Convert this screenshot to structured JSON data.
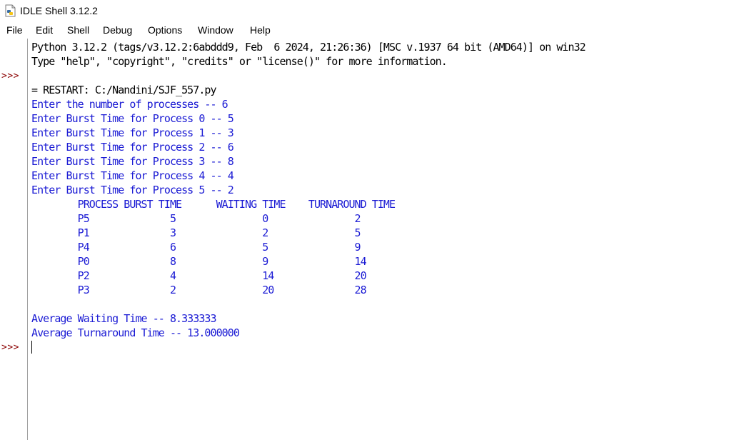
{
  "window": {
    "title": "IDLE Shell 3.12.2"
  },
  "menu": {
    "items": [
      "File",
      "Edit",
      "Shell",
      "Debug",
      "Options",
      "Window",
      "Help"
    ]
  },
  "shell": {
    "prompt": ">>>",
    "banner_line1": "Python 3.12.2 (tags/v3.12.2:6abddd9, Feb  6 2024, 21:26:36) [MSC v.1937 64 bit (AMD64)] on win32",
    "banner_line2": "Type \"help\", \"copyright\", \"credits\" or \"license()\" for more information.",
    "restart_line": "= RESTART: C:/Nandini/SJF_557.py",
    "output_lines": [
      "Enter the number of processes -- 6",
      "Enter Burst Time for Process 0 -- 5",
      "Enter Burst Time for Process 1 -- 3",
      "Enter Burst Time for Process 2 -- 6",
      "Enter Burst Time for Process 3 -- 8",
      "Enter Burst Time for Process 4 -- 4",
      "Enter Burst Time for Process 5 -- 2",
      "        PROCESS BURST TIME      WAITING TIME    TURNAROUND TIME",
      "        P5              5               0               2",
      "        P1              3               2               5",
      "        P4              6               5               9",
      "        P0              8               9               14",
      "        P2              4               14              20",
      "        P3              2               20              28",
      "",
      "Average Waiting Time -- 8.333333",
      "Average Turnaround Time -- 13.000000"
    ]
  },
  "colors": {
    "output": "#1a1ad4",
    "prompt": "#8b0000",
    "text": "#000000"
  }
}
